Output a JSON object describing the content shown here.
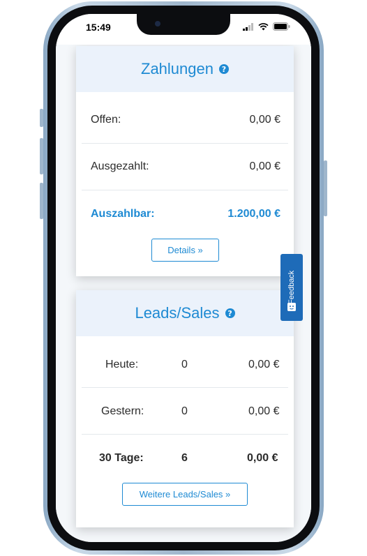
{
  "status_bar": {
    "time": "15:49"
  },
  "payments": {
    "title": "Zahlungen",
    "rows": [
      {
        "label": "Offen:",
        "value": "0,00 €"
      },
      {
        "label": "Ausgezahlt:",
        "value": "0,00 €"
      },
      {
        "label": "Auszahlbar:",
        "value": "1.200,00 €"
      }
    ],
    "details_button": "Details »"
  },
  "leads_sales": {
    "title": "Leads/Sales",
    "rows": [
      {
        "label": "Heute:",
        "count": "0",
        "value": "0,00 €"
      },
      {
        "label": "Gestern:",
        "count": "0",
        "value": "0,00 €"
      },
      {
        "label": "30 Tage:",
        "count": "6",
        "value": "0,00 €"
      }
    ],
    "more_button": "Weitere Leads/Sales »"
  },
  "feedback_tab": {
    "label": "Feedback"
  },
  "colors": {
    "accent": "#1e8ad3",
    "card_header": "#ebf2fb",
    "feedback": "#1e6bb8"
  },
  "icons": [
    "question-icon",
    "signal-icon",
    "wifi-icon",
    "battery-icon",
    "feedback-icon"
  ]
}
